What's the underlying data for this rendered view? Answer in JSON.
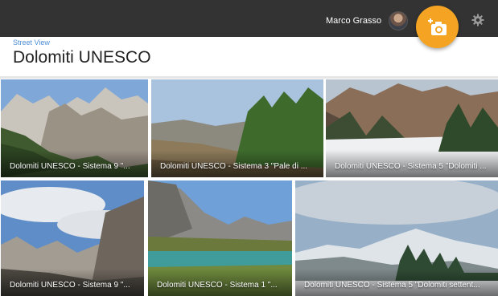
{
  "header": {
    "user_name": "Marco Grasso",
    "avatar_icon": "user-avatar",
    "add_photo_icon": "add-photo-camera-icon",
    "settings_icon": "gear-icon",
    "accent_color": "#f4a422",
    "bar_color": "#333333"
  },
  "breadcrumb": "Street View",
  "page_title": "Dolomiti UNESCO",
  "tiles": [
    {
      "caption": "Dolomiti UNESCO - Sistema 9 \"..."
    },
    {
      "caption": "Dolomiti UNESCO - Sistema 3 \"Pale di ..."
    },
    {
      "caption": "Dolomiti UNESCO - Sistema 5 \"Dolomiti ..."
    },
    {
      "caption": "Dolomiti UNESCO - Sistema 9 \"..."
    },
    {
      "caption": "Dolomiti UNESCO - Sistema 1 \"..."
    },
    {
      "caption": "Dolomiti UNESCO - Sistema 5 \"Dolomiti settent..."
    }
  ]
}
